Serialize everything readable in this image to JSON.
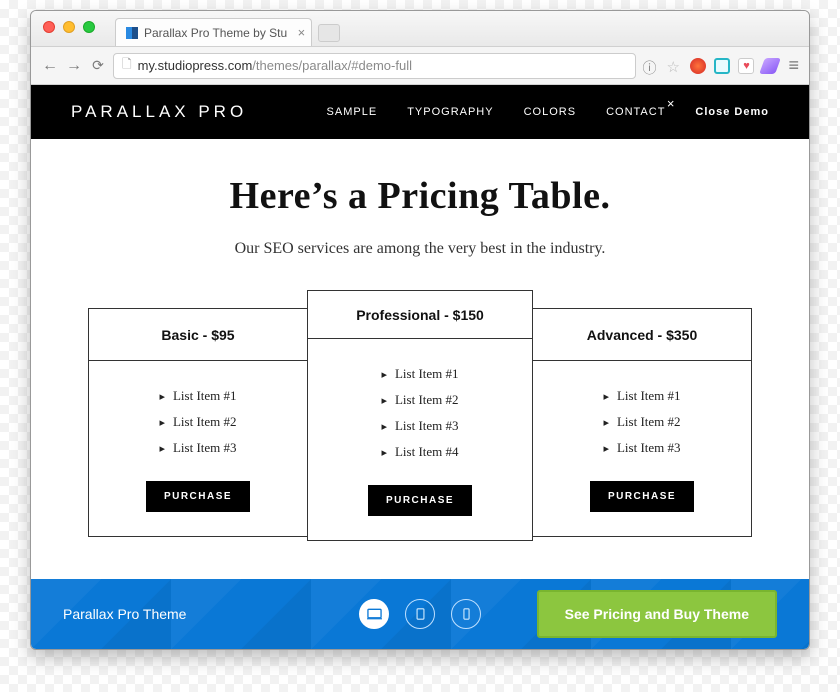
{
  "browser": {
    "tab_title": "Parallax Pro Theme by Stu",
    "url_host": "my.studiopress.com",
    "url_path": "/themes/parallax/#demo-full"
  },
  "navbar": {
    "logo": "PARALLAX PRO",
    "items": [
      "SAMPLE",
      "TYPOGRAPHY",
      "COLORS",
      "CONTACT"
    ],
    "close_demo": "Close Demo"
  },
  "hero": {
    "title": "Here’s a Pricing Table.",
    "subtitle": "Our SEO services are among the very best in the industry."
  },
  "plans": [
    {
      "title": "Basic - $95",
      "items": [
        "List Item #1",
        "List Item #2",
        "List Item #3"
      ],
      "button": "PURCHASE"
    },
    {
      "title": "Professional - $150",
      "items": [
        "List Item #1",
        "List Item #2",
        "List Item #3",
        "List Item #4"
      ],
      "button": "PURCHASE"
    },
    {
      "title": "Advanced - $350",
      "items": [
        "List Item #1",
        "List Item #2",
        "List Item #3"
      ],
      "button": "PURCHASE"
    }
  ],
  "footer": {
    "theme_name": "Parallax Pro Theme",
    "cta": "See Pricing and Buy Theme"
  }
}
